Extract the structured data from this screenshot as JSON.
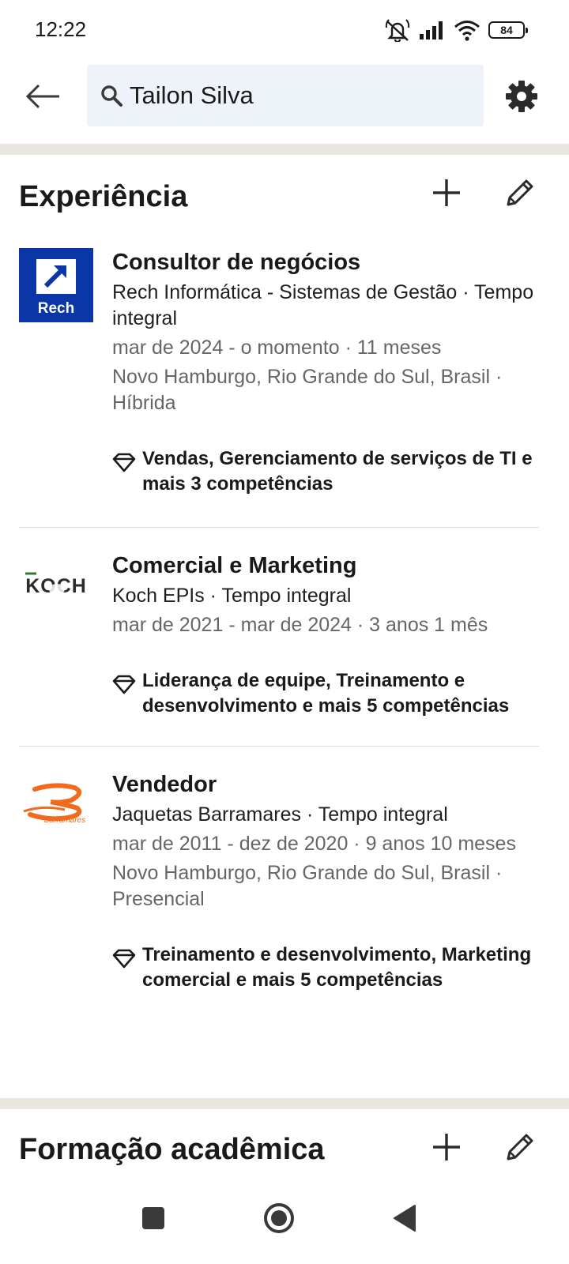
{
  "status_bar": {
    "time": "12:22",
    "battery": "84",
    "icons": [
      "mute-icon",
      "signal-icon",
      "wifi-icon",
      "battery-icon"
    ]
  },
  "header": {
    "search_query": "Tailon Silva",
    "icons": {
      "back": "arrow-left-icon",
      "search": "search-icon",
      "settings": "gear-icon"
    }
  },
  "colors": {
    "accent_blue": "#0a36a8",
    "band": "#e9e5df",
    "search_bg": "#edf3f8",
    "meta_gray": "#666666",
    "barramares_orange": "#f26a1b"
  },
  "experience": {
    "title": "Experiência",
    "items": [
      {
        "logo": "Rech",
        "title": "Consultor de negócios",
        "company": "Rech Informática - Sistemas de Gestão · Tempo integral",
        "dates": "mar de 2024 - o momento · 11 meses",
        "location": "Novo Hamburgo, Rio Grande do Sul, Brasil · Híbrida",
        "skills": "Vendas, Gerenciamento de serviços de TI e mais 3 competências"
      },
      {
        "logo": "KOCH",
        "title": "Comercial e Marketing",
        "company": "Koch EPIs · Tempo integral",
        "dates": "mar de 2021 - mar de 2024 · 3 anos 1 mês",
        "location": "",
        "skills": "Liderança de equipe, Treinamento e desenvolvimento e mais 5 competências"
      },
      {
        "logo": "Barramares",
        "title": "Vendedor",
        "company": "Jaquetas Barramares · Tempo integral",
        "dates": "mar de 2011 - dez de 2020 · 9 anos 10 meses",
        "location": "Novo Hamburgo, Rio Grande do Sul, Brasil · Presencial",
        "skills": "Treinamento e desenvolvimento, Marketing comercial e mais 5 competências"
      }
    ]
  },
  "education": {
    "title": "Formação acadêmica"
  },
  "nav_bar": {
    "buttons": [
      "recents-square-icon",
      "home-circle-icon",
      "back-triangle-icon"
    ]
  }
}
